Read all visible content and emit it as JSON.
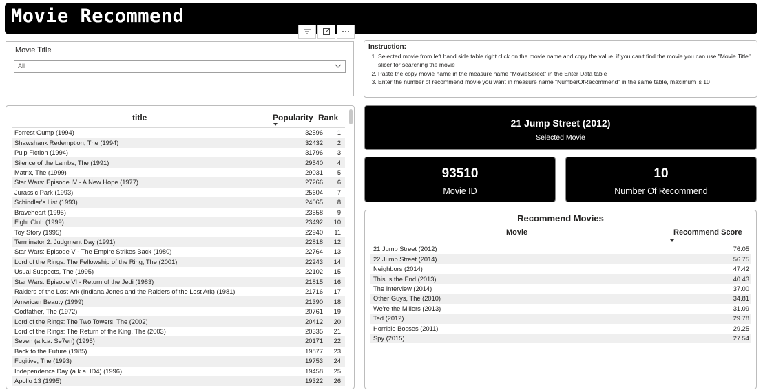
{
  "header": {
    "title": "Movie Recommend"
  },
  "visual_header_icons": [
    "filter-icon",
    "focus-mode-icon",
    "more-options-icon"
  ],
  "slicer": {
    "label": "Movie Title",
    "value": "All"
  },
  "instructions": {
    "heading": "Instruction:",
    "items": [
      "Selected movie from left hand side table right click on the movie name and copy the value, if you can't find the movie you can use \"Movie Title\" slicer for searching the movie",
      "Paste the copy movie name in the measure name \"MovieSelect\" in the Enter Data table",
      "Enter the number of recommend movie you want in measure name \"NumberOfRecommend\" in the same table, maximum is 10"
    ]
  },
  "movie_table": {
    "columns": [
      "title",
      "Popularity",
      "Rank"
    ],
    "rows": [
      [
        "Forrest Gump (1994)",
        "32596",
        "1"
      ],
      [
        "Shawshank Redemption, The (1994)",
        "32432",
        "2"
      ],
      [
        "Pulp Fiction (1994)",
        "31796",
        "3"
      ],
      [
        "Silence of the Lambs, The (1991)",
        "29540",
        "4"
      ],
      [
        "Matrix, The (1999)",
        "29031",
        "5"
      ],
      [
        "Star Wars: Episode IV - A New Hope (1977)",
        "27266",
        "6"
      ],
      [
        "Jurassic Park (1993)",
        "25604",
        "7"
      ],
      [
        "Schindler's List (1993)",
        "24065",
        "8"
      ],
      [
        "Braveheart (1995)",
        "23558",
        "9"
      ],
      [
        "Fight Club (1999)",
        "23492",
        "10"
      ],
      [
        "Toy Story (1995)",
        "22940",
        "11"
      ],
      [
        "Terminator 2: Judgment Day (1991)",
        "22818",
        "12"
      ],
      [
        "Star Wars: Episode V - The Empire Strikes Back (1980)",
        "22764",
        "13"
      ],
      [
        "Lord of the Rings: The Fellowship of the Ring, The (2001)",
        "22243",
        "14"
      ],
      [
        "Usual Suspects, The (1995)",
        "22102",
        "15"
      ],
      [
        "Star Wars: Episode VI - Return of the Jedi (1983)",
        "21815",
        "16"
      ],
      [
        "Raiders of the Lost Ark (Indiana Jones and the Raiders of the Lost Ark) (1981)",
        "21716",
        "17"
      ],
      [
        "American Beauty (1999)",
        "21390",
        "18"
      ],
      [
        "Godfather, The (1972)",
        "20761",
        "19"
      ],
      [
        "Lord of the Rings: The Two Towers, The (2002)",
        "20412",
        "20"
      ],
      [
        "Lord of the Rings: The Return of the King, The (2003)",
        "20335",
        "21"
      ],
      [
        "Seven (a.k.a. Se7en) (1995)",
        "20171",
        "22"
      ],
      [
        "Back to the Future (1985)",
        "19877",
        "23"
      ],
      [
        "Fugitive, The (1993)",
        "19753",
        "24"
      ],
      [
        "Independence Day (a.k.a. ID4) (1996)",
        "19458",
        "25"
      ],
      [
        "Apollo 13 (1995)",
        "19322",
        "26"
      ]
    ]
  },
  "cards": {
    "selected_movie": {
      "value": "21 Jump Street (2012)",
      "label": "Selected Movie"
    },
    "movie_id": {
      "value": "93510",
      "label": "Movie ID"
    },
    "num_recommend": {
      "value": "10",
      "label": "Number Of Recommend"
    }
  },
  "recommend": {
    "title": "Recommend Movies",
    "columns": [
      "Movie",
      "Recommend Score"
    ],
    "rows": [
      [
        "21 Jump Street (2012)",
        "76.05"
      ],
      [
        "22 Jump Street (2014)",
        "56.75"
      ],
      [
        "Neighbors (2014)",
        "47.42"
      ],
      [
        "This Is the End (2013)",
        "40.43"
      ],
      [
        "The Interview (2014)",
        "37.00"
      ],
      [
        "Other Guys, The (2010)",
        "34.81"
      ],
      [
        "We're the Millers (2013)",
        "31.09"
      ],
      [
        "Ted (2012)",
        "29.78"
      ],
      [
        "Horrible Bosses (2011)",
        "29.25"
      ],
      [
        "Spy (2015)",
        "27.54"
      ]
    ]
  }
}
